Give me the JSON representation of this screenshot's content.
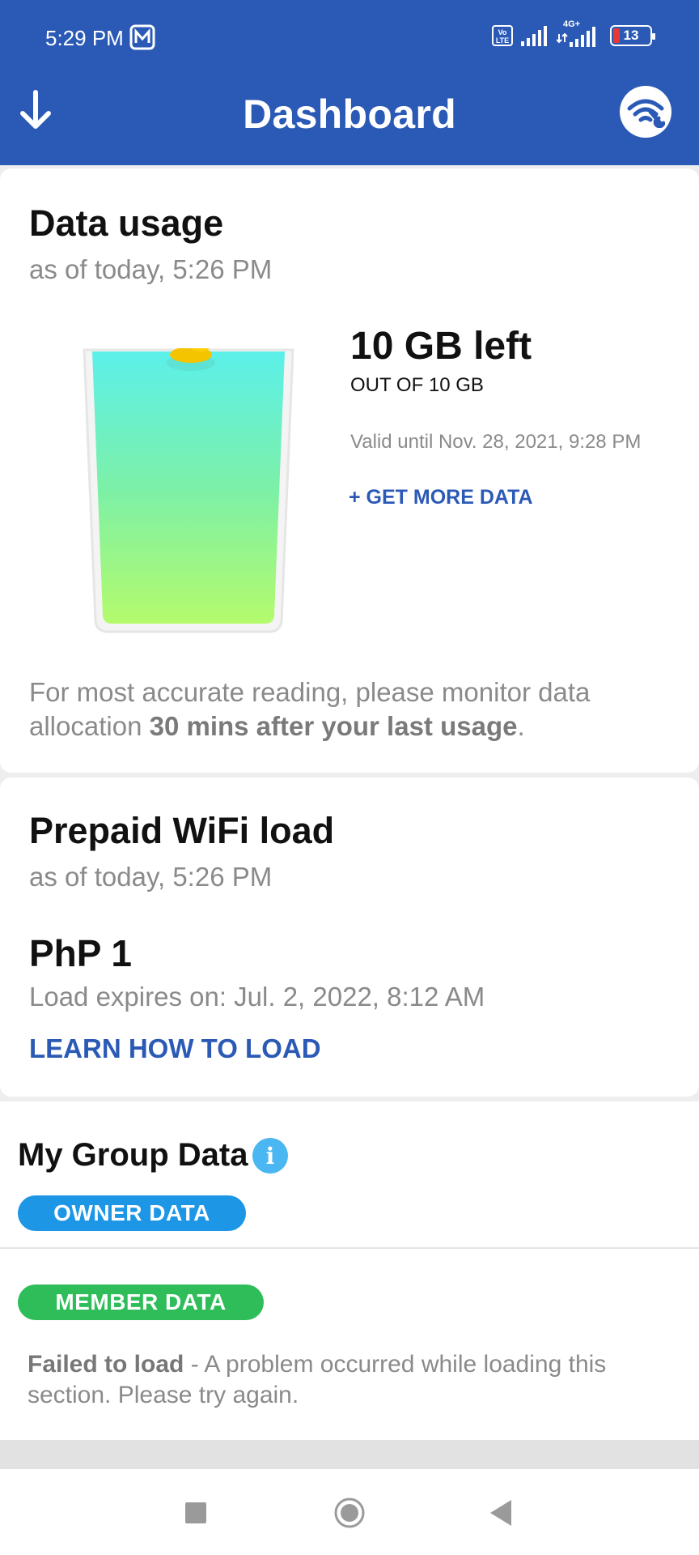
{
  "status": {
    "time": "5:29 PM",
    "volte": "Vo LTE",
    "network": "4G+",
    "battery": "13"
  },
  "header": {
    "title": "Dashboard",
    "left_icon": "download-arrow-icon",
    "right_icon": "wifi-tools-icon"
  },
  "data_usage": {
    "title": "Data usage",
    "subtitle": "as of today, 5:26 PM",
    "left": "10 GB left",
    "out_of": "OUT OF 10 GB",
    "valid": "Valid until Nov. 28, 2021, 9:28 PM",
    "get_more": "+ GET MORE DATA",
    "fill_fraction": 1.0,
    "note_prefix": "For most accurate reading, please monitor data allocation ",
    "note_bold": "30 mins after your last usage",
    "note_suffix": "."
  },
  "prepaid": {
    "title": "Prepaid WiFi load",
    "subtitle": "as of today, 5:26 PM",
    "amount": "PhP 1",
    "expires": "Load expires on: Jul. 2, 2022, 8:12 AM",
    "learn": "LEARN HOW TO LOAD"
  },
  "group": {
    "title": "My Group Data",
    "info": "i",
    "owner_pill": "OWNER DATA",
    "member_pill": "MEMBER DATA",
    "failed_bold": "Failed to load",
    "failed_text": " - A problem occurred while loading this section. Please try again."
  },
  "colors": {
    "header": "#2b5ab6",
    "link": "#2b5ab6",
    "owner": "#1e96e6",
    "member": "#2fbd5a",
    "info": "#4ab6f2"
  }
}
